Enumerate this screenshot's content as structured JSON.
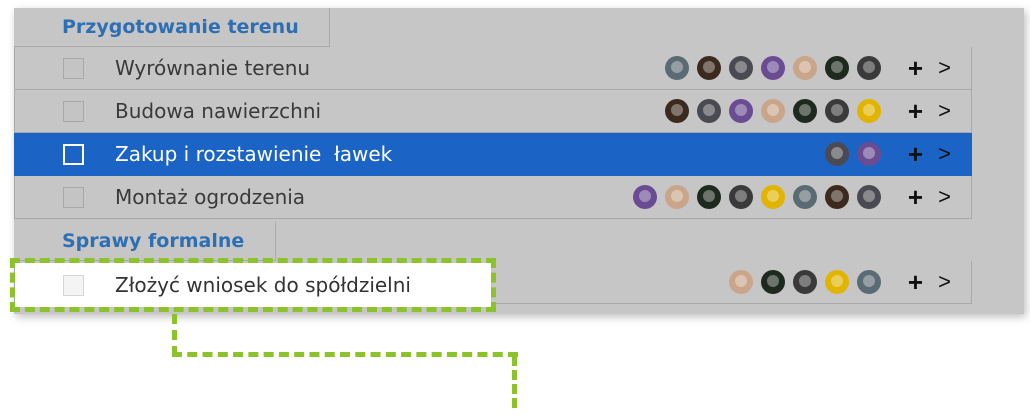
{
  "sections": [
    {
      "title": "Przygotowanie terenu",
      "tasks": [
        {
          "label": "Wyrównanie terenu",
          "avatars": 7
        },
        {
          "label": "Budowa nawierzchni",
          "avatars": 7
        },
        {
          "label": "Zakup i rozstawienie  ławek",
          "avatars": 2,
          "selected": true
        },
        {
          "label": "Montaż ogrodzenia",
          "avatars": 8
        }
      ]
    },
    {
      "title": "Sprawy formalne",
      "tasks": [
        {
          "label": "Złożyć wniosek do spółdzielni",
          "avatars": 5
        }
      ]
    }
  ],
  "add_icon": "+",
  "chevron_icon": ">",
  "colors": {
    "selected_row": "#1b63c4",
    "section_title": "#2e6fb4",
    "highlight": "#8cc22a",
    "dim_background": "#c6c6c6"
  },
  "avatar_palette": [
    "#5b6b73",
    "#3c2a1f",
    "#4a4a52",
    "#6a4c93",
    "#c9a58a",
    "#1e2a1e",
    "#3a3a3a",
    "#e0b400"
  ]
}
